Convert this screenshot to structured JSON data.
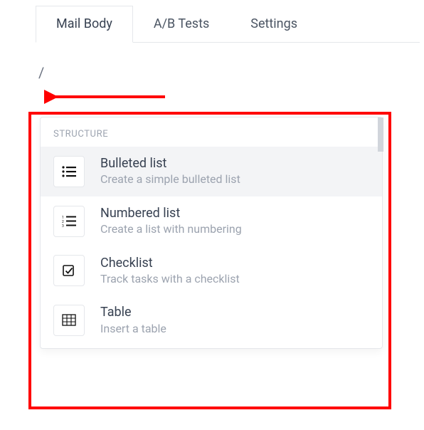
{
  "tabs": [
    {
      "label": "Mail Body",
      "active": true
    },
    {
      "label": "A/B Tests",
      "active": false
    },
    {
      "label": "Settings",
      "active": false
    }
  ],
  "editor": {
    "slash": "/"
  },
  "menu": {
    "section": "STRUCTURE",
    "items": [
      {
        "icon": "bulleted-list-icon",
        "title": "Bulleted list",
        "desc": "Create a simple bulleted list",
        "hover": true
      },
      {
        "icon": "numbered-list-icon",
        "title": "Numbered list",
        "desc": "Create a list with numbering",
        "hover": false
      },
      {
        "icon": "checklist-icon",
        "title": "Checklist",
        "desc": "Track tasks with a checklist",
        "hover": false
      },
      {
        "icon": "table-icon",
        "title": "Table",
        "desc": "Insert a table",
        "hover": false
      }
    ]
  }
}
